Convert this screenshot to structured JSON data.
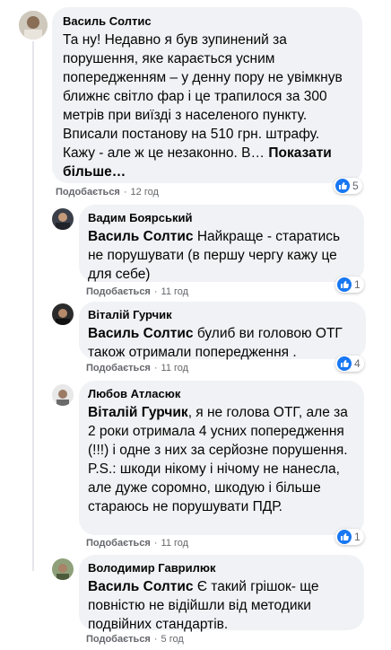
{
  "comments": [
    {
      "author": "Василь Солтис",
      "text": "Та ну! Недавно я був зупинений за порушення, яке карається усним попередженням – у денну пору не увімкнув ближнє світло фар і це трапилося за 300 метрів при виїзді з населеного пункту. Вписали постанову на 510 грн. штрафу. Кажу - але ж це незаконно. В…",
      "see_more": "Показати більше…",
      "like_label": "Подобається",
      "time": "12 год",
      "reactions": "5"
    },
    {
      "author": "Вадим Боярський",
      "mention": "Василь Солтис",
      "text": "Найкраще - старатись не порушувати (в першу чергу кажу це для себе)",
      "like_label": "Подобається",
      "time": "11 год",
      "reactions": "1"
    },
    {
      "author": "Віталій Гурчик",
      "mention": "Василь Солтис",
      "text": "булиб ви головою ОТГ також отримали попередження .",
      "like_label": "Подобається",
      "time": "11 год",
      "reactions": "4"
    },
    {
      "author": "Любов Атласюк",
      "mention": "Віталій Гурчик",
      "text": ", я не голова ОТГ, але за 2 роки отримала 4 усних попередження (!!!) і одне з них за серйозне порушення.\nP.S.: шкоди нікому і нічому не нанесла, але дуже соромно, шкодую і більше стараюсь не порушувати ПДР.",
      "like_label": "Подобається",
      "time": "11 год",
      "reactions": "1"
    },
    {
      "author": "Володимир Гаврилюк",
      "mention": "Василь Солтис",
      "text": "Є такий грішок- ще повністю не відійшли від методики подвійних стандартів.",
      "like_label": "Подобається",
      "time": "5 год"
    }
  ],
  "colors": {
    "bubble": "#f0f2f5",
    "like_blue": "#1877f2",
    "meta_text": "#65676b"
  },
  "icons": [
    "like-icon",
    "avatar"
  ]
}
